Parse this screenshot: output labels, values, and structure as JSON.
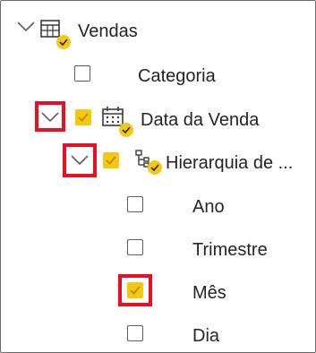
{
  "fields_pane": {
    "table": {
      "label": "Vendas",
      "expanded": true,
      "icon": "table-icon"
    },
    "items": [
      {
        "label": "Categoria",
        "checked": false
      },
      {
        "label": "Data da Venda",
        "checked": true,
        "expanded": true,
        "icon": "calendar-icon"
      },
      {
        "label": "Hierarquia de ...",
        "checked": true,
        "expanded": true,
        "icon": "hierarchy-icon"
      },
      {
        "label": "Ano",
        "checked": false
      },
      {
        "label": "Trimestre",
        "checked": false
      },
      {
        "label": "Mês",
        "checked": true
      },
      {
        "label": "Dia",
        "checked": false
      }
    ]
  },
  "colors": {
    "accent": "#f2c811",
    "highlight": "#e81123",
    "text": "#252423"
  }
}
